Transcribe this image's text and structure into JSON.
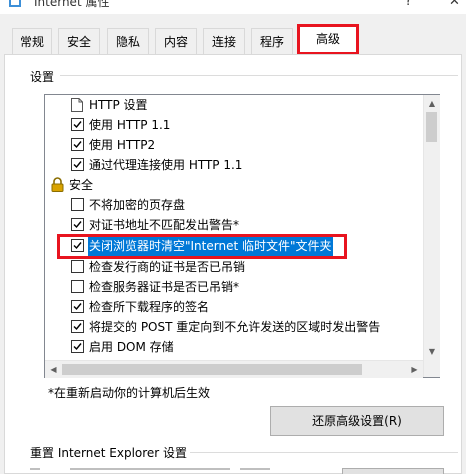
{
  "window": {
    "title": "Internet 属性",
    "help_label": "?",
    "close_label": "✕"
  },
  "tabs": [
    {
      "label": "常规"
    },
    {
      "label": "安全"
    },
    {
      "label": "隐私"
    },
    {
      "label": "内容"
    },
    {
      "label": "连接"
    },
    {
      "label": "程序"
    },
    {
      "label": "高级",
      "active": true
    }
  ],
  "settings": {
    "legend": "设置",
    "items": [
      {
        "label": "HTTP 设置",
        "type": "category",
        "icon": "document-icon"
      },
      {
        "label": "使用 HTTP 1.1",
        "type": "checkbox",
        "checked": true
      },
      {
        "label": "使用 HTTP2",
        "type": "checkbox",
        "checked": true
      },
      {
        "label": "通过代理连接使用 HTTP 1.1",
        "type": "checkbox",
        "checked": true
      },
      {
        "label": "安全",
        "type": "category",
        "icon": "lock-icon"
      },
      {
        "label": "不将加密的页存盘",
        "type": "checkbox",
        "checked": false
      },
      {
        "label": "对证书地址不匹配发出警告*",
        "type": "checkbox",
        "checked": true
      },
      {
        "label": "关闭浏览器时清空\"Internet 临时文件\"文件夹",
        "type": "checkbox",
        "checked": true,
        "selected": true
      },
      {
        "label": "检查发行商的证书是否已吊销",
        "type": "checkbox",
        "checked": false
      },
      {
        "label": "检查服务器证书是否已吊销*",
        "type": "checkbox",
        "checked": false
      },
      {
        "label": "检查所下载程序的签名",
        "type": "checkbox",
        "checked": true
      },
      {
        "label": "将提交的 POST 重定向到不允许发送的区域时发出警告",
        "type": "checkbox",
        "checked": true
      },
      {
        "label": "启用 DOM 存储",
        "type": "checkbox",
        "checked": true
      }
    ],
    "note": "*在重新启动你的计算机后生效",
    "restore_button": "还原高级设置(R)"
  },
  "reset": {
    "title": "重置 Internet Explorer 设置"
  },
  "colors": {
    "highlight": "#0078d7",
    "annotation": "#e8141f",
    "lock": "#d9a300"
  }
}
